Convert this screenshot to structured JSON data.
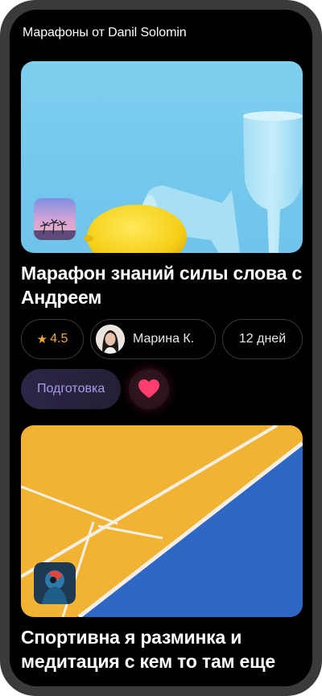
{
  "header": {
    "title": "Марафоны от Danil Solomin"
  },
  "colors": {
    "accent_star": "#f2a43a",
    "like": "#ff3d6e",
    "status_text": "#a99ae8"
  },
  "cards": [
    {
      "title": "Марафон знаний силы слова с Андреем",
      "rating_icon": "star-icon",
      "rating": "4.5",
      "author_name": "Марина К.",
      "duration": "12 дней",
      "status": "Подготовка",
      "liked": true
    },
    {
      "title": "Спортивна я разминка и медитация с кем то там еще"
    }
  ]
}
